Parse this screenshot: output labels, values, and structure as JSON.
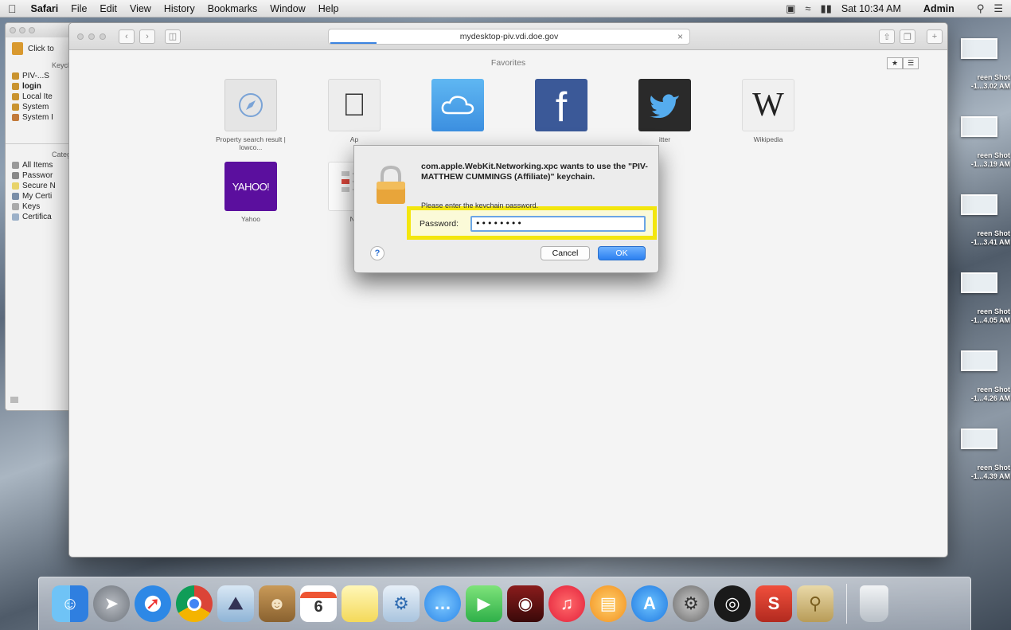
{
  "menubar": {
    "app": "Safari",
    "items": [
      "File",
      "Edit",
      "View",
      "History",
      "Bookmarks",
      "Window",
      "Help"
    ],
    "clock": "Sat 10:34 AM",
    "user": "Admin"
  },
  "keychain": {
    "lock_label": "Click to",
    "section_keychains": "Keychai",
    "keychains": [
      "PIV-...S",
      "login",
      "Local Ite",
      "System",
      "System I"
    ],
    "section_category": "Categor",
    "categories": [
      "All Items",
      "Passwor",
      "Secure N",
      "My Certi",
      "Keys",
      "Certifica"
    ]
  },
  "desktop": {
    "shots": [
      {
        "label": "reen Shot",
        "sub": "-1...3.02 AM"
      },
      {
        "label": "reen Shot",
        "sub": "-1...3.19 AM"
      },
      {
        "label": "reen Shot",
        "sub": "-1...3.41 AM"
      },
      {
        "label": "reen Shot",
        "sub": "-1...4.05 AM"
      },
      {
        "label": "reen Shot",
        "sub": "-1...4.26 AM"
      },
      {
        "label": "reen Shot",
        "sub": "-1...4.39 AM"
      }
    ]
  },
  "safari": {
    "url": "mydesktop-piv.vdi.doe.gov",
    "page_title": "Favorites",
    "favorites": [
      {
        "label": "Property search result | lowco..."
      },
      {
        "label": "Ap"
      },
      {
        "label": ""
      },
      {
        "label": ""
      },
      {
        "label": "itter"
      },
      {
        "label": "Wikipedia"
      },
      {
        "label": "Yahoo"
      },
      {
        "label": "Ne"
      }
    ],
    "yahoo_logo": "YAHOO!",
    "wiki_logo": "W",
    "fb_logo": "f"
  },
  "dialog": {
    "message": "com.apple.WebKit.Networking.xpc wants to use the \"PIV-MATTHEW CUMMINGS (Affiliate)\" keychain.",
    "subtitle": "Please enter the keychain password.",
    "password_label": "Password:",
    "password_value": "••••••••",
    "cancel_label": "Cancel",
    "ok_label": "OK",
    "help_label": "?"
  },
  "dock": {
    "calendar_day": "6",
    "icons": [
      "finder-icon",
      "launchpad-icon",
      "safari-icon",
      "chrome-icon",
      "preview-icon",
      "contacts-icon",
      "calendar-icon",
      "notes-icon",
      "photo-icon",
      "messages-icon",
      "facetime-icon",
      "photobooth-icon",
      "itunes-icon",
      "ibooks-icon",
      "appstore-icon",
      "system-prefs-icon",
      "audio-icon",
      "citrix-icon",
      "keychain-icon",
      "trash-icon"
    ]
  },
  "colors": {
    "highlight": "#f3e60e",
    "ok_button": "#2b7ff0",
    "yahoo": "#5b0f9e",
    "facebook": "#3b5998"
  }
}
